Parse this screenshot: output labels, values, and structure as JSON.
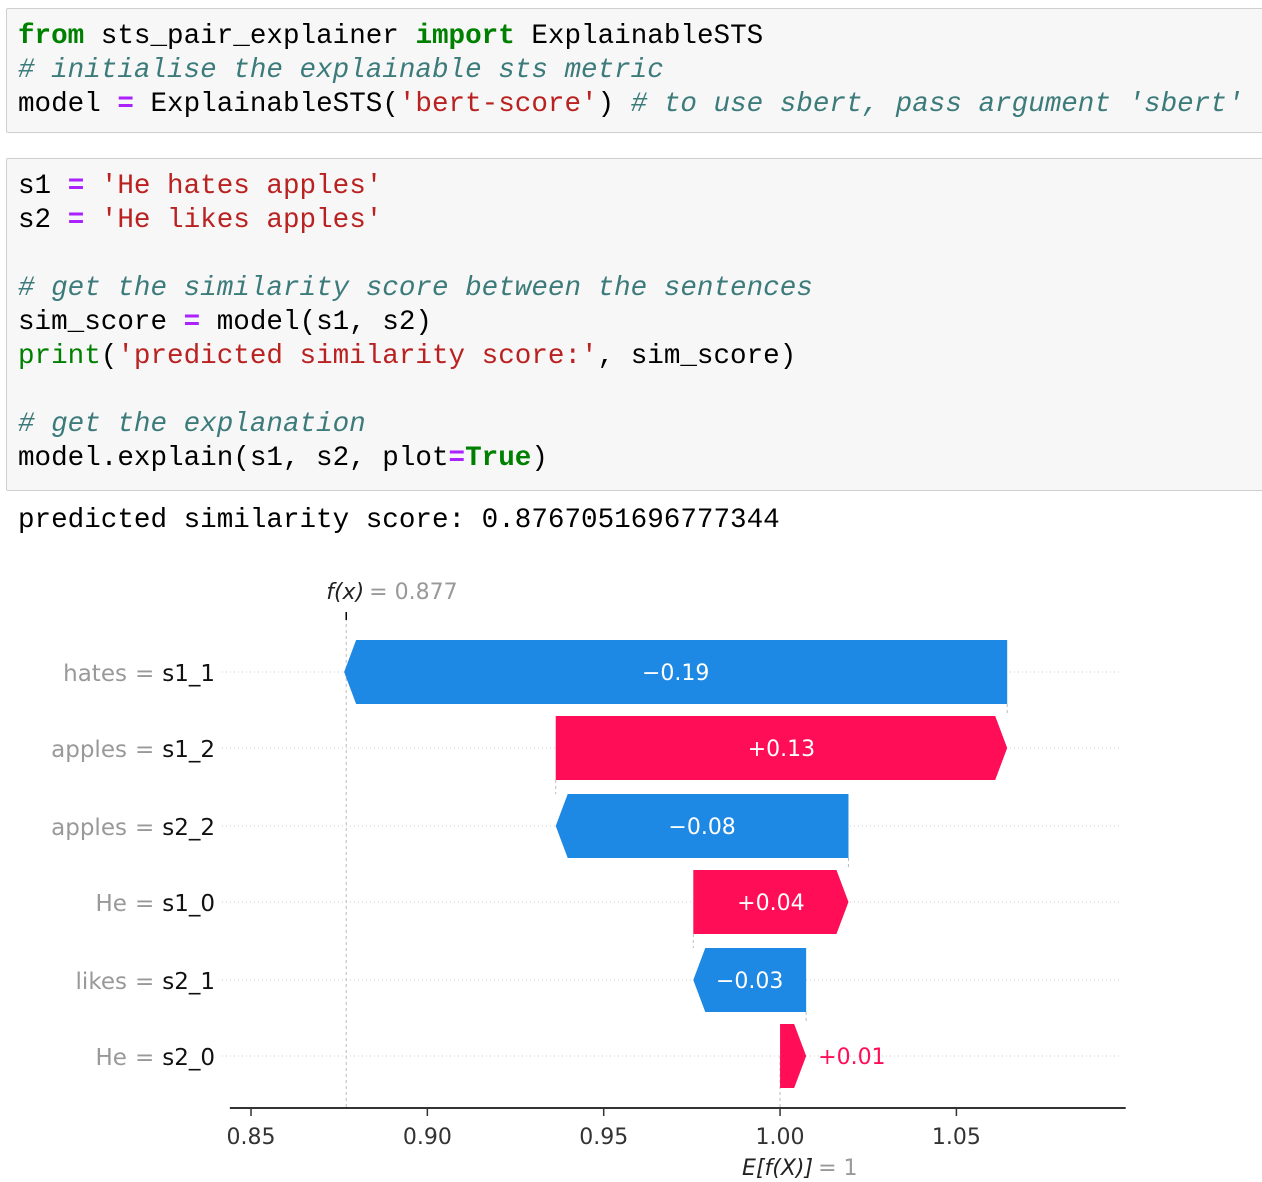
{
  "cells": [
    {
      "lines": [
        [
          {
            "t": "kw",
            "s": "from"
          },
          {
            "t": "n",
            "s": " sts_pair_explainer "
          },
          {
            "t": "kw",
            "s": "import"
          },
          {
            "t": "n",
            "s": " ExplainableSTS"
          }
        ],
        [
          {
            "t": "cm",
            "s": "# initialise the explainable sts metric"
          }
        ],
        [
          {
            "t": "n",
            "s": "model "
          },
          {
            "t": "op",
            "s": "="
          },
          {
            "t": "n",
            "s": " ExplainableSTS("
          },
          {
            "t": "str",
            "s": "'bert-score'"
          },
          {
            "t": "n",
            "s": ") "
          },
          {
            "t": "cm",
            "s": "# to use sbert, pass argument 'sbert'"
          }
        ]
      ]
    },
    {
      "lines": [
        [
          {
            "t": "n",
            "s": "s1 "
          },
          {
            "t": "op",
            "s": "="
          },
          {
            "t": "n",
            "s": " "
          },
          {
            "t": "str",
            "s": "'He hates apples'"
          }
        ],
        [
          {
            "t": "n",
            "s": "s2 "
          },
          {
            "t": "op",
            "s": "="
          },
          {
            "t": "n",
            "s": " "
          },
          {
            "t": "str",
            "s": "'He likes apples'"
          }
        ],
        [],
        [
          {
            "t": "cm",
            "s": "# get the similarity score between the sentences"
          }
        ],
        [
          {
            "t": "n",
            "s": "sim_score "
          },
          {
            "t": "op",
            "s": "="
          },
          {
            "t": "n",
            "s": " model(s1, s2)"
          }
        ],
        [
          {
            "t": "bi",
            "s": "print"
          },
          {
            "t": "n",
            "s": "("
          },
          {
            "t": "str",
            "s": "'predicted similarity score:'"
          },
          {
            "t": "n",
            "s": ", sim_score)"
          }
        ],
        [],
        [
          {
            "t": "cm",
            "s": "# get the explanation"
          }
        ],
        [
          {
            "t": "n",
            "s": "model.explain(s1, s2, plot"
          },
          {
            "t": "op",
            "s": "="
          },
          {
            "t": "kw",
            "s": "True"
          },
          {
            "t": "n",
            "s": ")"
          }
        ]
      ]
    }
  ],
  "output": "predicted similarity score: 0.8767051696777344",
  "chart_data": {
    "type": "waterfall",
    "base_value": 1,
    "base_label_prefix": "E[f(X)]",
    "base_label_value": "= 1",
    "output_value": 0.877,
    "output_label_prefix": "f(x)",
    "output_label_value": "= 0.877",
    "xlim": [
      0.844,
      1.098
    ],
    "xticks": [
      "0.85",
      "0.90",
      "0.95",
      "1.00",
      "1.05"
    ],
    "xtick_values": [
      0.85,
      0.9,
      0.95,
      1.0,
      1.05
    ],
    "positive_color": "#ff0d57",
    "negative_color": "#1e88e5",
    "features": [
      {
        "name": "hates",
        "eq": "=",
        "feature": "s1_1",
        "value": -0.188,
        "label": "−0.19"
      },
      {
        "name": "apples",
        "eq": "=",
        "feature": "s1_2",
        "value": 0.128,
        "label": "+0.13"
      },
      {
        "name": "apples",
        "eq": "=",
        "feature": "s2_2",
        "value": -0.083,
        "label": "−0.08"
      },
      {
        "name": "He",
        "eq": "=",
        "feature": "s1_0",
        "value": 0.044,
        "label": "+0.04"
      },
      {
        "name": "likes",
        "eq": "=",
        "feature": "s2_1",
        "value": -0.032,
        "label": "−0.03"
      },
      {
        "name": "He",
        "eq": "=",
        "feature": "s2_0",
        "value": 0.0074,
        "label": "+0.01"
      }
    ]
  }
}
